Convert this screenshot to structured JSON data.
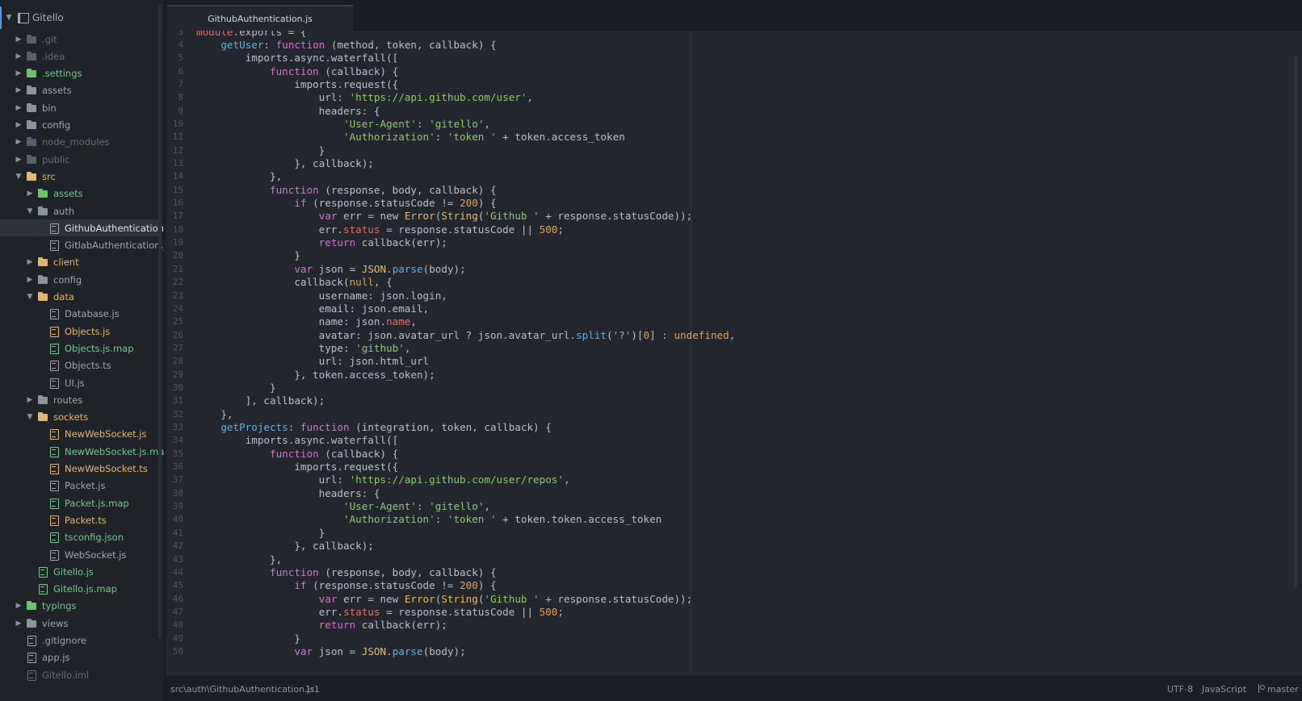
{
  "project": {
    "name": "Gitello",
    "icon": "repo-icon"
  },
  "tree": [
    {
      "label": ".git",
      "type": "folder",
      "depth": 1,
      "expanded": false,
      "status": "dim"
    },
    {
      "label": ".idea",
      "type": "folder",
      "depth": 1,
      "expanded": false,
      "status": "dim"
    },
    {
      "label": ".settings",
      "type": "folder",
      "depth": 1,
      "expanded": false,
      "status": "green"
    },
    {
      "label": "assets",
      "type": "folder",
      "depth": 1,
      "expanded": false,
      "status": "plain"
    },
    {
      "label": "bin",
      "type": "folder",
      "depth": 1,
      "expanded": false,
      "status": "plain"
    },
    {
      "label": "config",
      "type": "folder",
      "depth": 1,
      "expanded": false,
      "status": "plain"
    },
    {
      "label": "node_modules",
      "type": "folder",
      "depth": 1,
      "expanded": false,
      "status": "dim"
    },
    {
      "label": "public",
      "type": "folder",
      "depth": 1,
      "expanded": false,
      "status": "dim"
    },
    {
      "label": "src",
      "type": "folder",
      "depth": 1,
      "expanded": true,
      "status": "orange"
    },
    {
      "label": "assets",
      "type": "folder",
      "depth": 2,
      "expanded": false,
      "status": "green"
    },
    {
      "label": "auth",
      "type": "folder",
      "depth": 2,
      "expanded": true,
      "status": "plain"
    },
    {
      "label": "GithubAuthentication.js",
      "type": "file",
      "depth": 3,
      "status": "plain",
      "selected": true
    },
    {
      "label": "GitlabAuthentication.js",
      "type": "file",
      "depth": 3,
      "status": "plain"
    },
    {
      "label": "client",
      "type": "folder",
      "depth": 2,
      "expanded": false,
      "status": "orange"
    },
    {
      "label": "config",
      "type": "folder",
      "depth": 2,
      "expanded": false,
      "status": "plain"
    },
    {
      "label": "data",
      "type": "folder",
      "depth": 2,
      "expanded": true,
      "status": "orange"
    },
    {
      "label": "Database.js",
      "type": "file",
      "depth": 3,
      "status": "plain"
    },
    {
      "label": "Objects.js",
      "type": "file",
      "depth": 3,
      "status": "orange"
    },
    {
      "label": "Objects.js.map",
      "type": "file",
      "depth": 3,
      "status": "green"
    },
    {
      "label": "Objects.ts",
      "type": "file",
      "depth": 3,
      "status": "plain"
    },
    {
      "label": "UI.js",
      "type": "file",
      "depth": 3,
      "status": "plain"
    },
    {
      "label": "routes",
      "type": "folder",
      "depth": 2,
      "expanded": false,
      "status": "plain"
    },
    {
      "label": "sockets",
      "type": "folder",
      "depth": 2,
      "expanded": true,
      "status": "orange"
    },
    {
      "label": "NewWebSocket.js",
      "type": "file",
      "depth": 3,
      "status": "orange"
    },
    {
      "label": "NewWebSocket.js.map",
      "type": "file",
      "depth": 3,
      "status": "green"
    },
    {
      "label": "NewWebSocket.ts",
      "type": "file",
      "depth": 3,
      "status": "orange"
    },
    {
      "label": "Packet.js",
      "type": "file",
      "depth": 3,
      "status": "plain"
    },
    {
      "label": "Packet.js.map",
      "type": "file",
      "depth": 3,
      "status": "green"
    },
    {
      "label": "Packet.ts",
      "type": "file",
      "depth": 3,
      "status": "orange"
    },
    {
      "label": "tsconfig.json",
      "type": "file",
      "depth": 3,
      "status": "green"
    },
    {
      "label": "WebSocket.js",
      "type": "file",
      "depth": 3,
      "status": "plain"
    },
    {
      "label": "Gitello.js",
      "type": "file",
      "depth": 2,
      "status": "green"
    },
    {
      "label": "Gitello.js.map",
      "type": "file",
      "depth": 2,
      "status": "green"
    },
    {
      "label": "typings",
      "type": "folder",
      "depth": 1,
      "expanded": false,
      "status": "green"
    },
    {
      "label": "views",
      "type": "folder",
      "depth": 1,
      "expanded": false,
      "status": "plain"
    },
    {
      "label": ".gitignore",
      "type": "file",
      "depth": 1,
      "status": "plain"
    },
    {
      "label": "app.js",
      "type": "file",
      "depth": 1,
      "status": "plain"
    },
    {
      "label": "Gitello.iml",
      "type": "file",
      "depth": 1,
      "status": "dim"
    }
  ],
  "tab": {
    "title": "GithubAuthentication.js"
  },
  "editor": {
    "lines": [
      {
        "n": "3",
        "t": [
          [
            "prop",
            "module"
          ],
          [
            "p",
            ".exports = {"
          ]
        ]
      },
      {
        "n": "4",
        "t": [
          [
            "p",
            "    "
          ],
          [
            "fn",
            "getUser"
          ],
          [
            "p",
            ": "
          ],
          [
            "kw",
            "function"
          ],
          [
            "p",
            " (method, token, callback) {"
          ]
        ]
      },
      {
        "n": "5",
        "t": [
          [
            "p",
            "        imports.async.waterfall(["
          ]
        ]
      },
      {
        "n": "6",
        "t": [
          [
            "p",
            "            "
          ],
          [
            "kw",
            "function"
          ],
          [
            "p",
            " (callback) {"
          ]
        ]
      },
      {
        "n": "7",
        "t": [
          [
            "p",
            "                imports.request({"
          ]
        ]
      },
      {
        "n": "8",
        "t": [
          [
            "p",
            "                    url: "
          ],
          [
            "str",
            "'https://api.github.com/user'"
          ],
          [
            "p",
            ","
          ]
        ]
      },
      {
        "n": "9",
        "t": [
          [
            "p",
            "                    headers: {"
          ]
        ]
      },
      {
        "n": "10",
        "t": [
          [
            "p",
            "                        "
          ],
          [
            "str",
            "'User-Agent'"
          ],
          [
            "p",
            ": "
          ],
          [
            "str",
            "'gitello'"
          ],
          [
            "p",
            ","
          ]
        ]
      },
      {
        "n": "11",
        "t": [
          [
            "p",
            "                        "
          ],
          [
            "str",
            "'Authorization'"
          ],
          [
            "p",
            ": "
          ],
          [
            "str",
            "'token '"
          ],
          [
            "p",
            " + token.access_token"
          ]
        ]
      },
      {
        "n": "12",
        "t": [
          [
            "p",
            "                    }"
          ]
        ]
      },
      {
        "n": "13",
        "t": [
          [
            "p",
            "                }, callback);"
          ]
        ]
      },
      {
        "n": "14",
        "t": [
          [
            "p",
            "            },"
          ]
        ]
      },
      {
        "n": "15",
        "t": [
          [
            "p",
            "            "
          ],
          [
            "kw",
            "function"
          ],
          [
            "p",
            " (response, body, callback) {"
          ]
        ]
      },
      {
        "n": "16",
        "t": [
          [
            "p",
            "                "
          ],
          [
            "kw",
            "if"
          ],
          [
            "p",
            " (response.statusCode != "
          ],
          [
            "num",
            "200"
          ],
          [
            "p",
            ") {"
          ]
        ]
      },
      {
        "n": "17",
        "t": [
          [
            "p",
            "                    "
          ],
          [
            "kw",
            "var"
          ],
          [
            "p",
            " err = new "
          ],
          [
            "cls",
            "Error"
          ],
          [
            "p",
            "("
          ],
          [
            "cls",
            "String"
          ],
          [
            "p",
            "("
          ],
          [
            "str",
            "'Github '"
          ],
          [
            "p",
            " + response.statusCode));"
          ]
        ]
      },
      {
        "n": "18",
        "t": [
          [
            "p",
            "                    err."
          ],
          [
            "prop",
            "status"
          ],
          [
            "p",
            " = response.statusCode || "
          ],
          [
            "num",
            "500"
          ],
          [
            "p",
            ";"
          ]
        ]
      },
      {
        "n": "19",
        "t": [
          [
            "p",
            "                    "
          ],
          [
            "kw",
            "return"
          ],
          [
            "p",
            " callback(err);"
          ]
        ]
      },
      {
        "n": "20",
        "t": [
          [
            "p",
            "                }"
          ]
        ]
      },
      {
        "n": "21",
        "t": [
          [
            "p",
            "                "
          ],
          [
            "kw",
            "var"
          ],
          [
            "p",
            " json = "
          ],
          [
            "cls",
            "JSON"
          ],
          [
            "p",
            "."
          ],
          [
            "fn",
            "parse"
          ],
          [
            "p",
            "(body);"
          ]
        ]
      },
      {
        "n": "22",
        "t": [
          [
            "p",
            "                callback("
          ],
          [
            "num",
            "null"
          ],
          [
            "p",
            ", {"
          ]
        ]
      },
      {
        "n": "23",
        "t": [
          [
            "p",
            "                    username: json.login,"
          ]
        ]
      },
      {
        "n": "24",
        "t": [
          [
            "p",
            "                    email: json.email,"
          ]
        ]
      },
      {
        "n": "25",
        "t": [
          [
            "p",
            "                    name: json."
          ],
          [
            "prop",
            "name"
          ],
          [
            "p",
            ","
          ]
        ]
      },
      {
        "n": "26",
        "t": [
          [
            "p",
            "                    avatar: json.avatar_url ? json.avatar_url."
          ],
          [
            "fn",
            "split"
          ],
          [
            "p",
            "("
          ],
          [
            "str",
            "'?'"
          ],
          [
            "p",
            ")["
          ],
          [
            "num",
            "0"
          ],
          [
            "p",
            "] : "
          ],
          [
            "num",
            "undefined"
          ],
          [
            "p",
            ","
          ]
        ]
      },
      {
        "n": "27",
        "t": [
          [
            "p",
            "                    type: "
          ],
          [
            "str",
            "'github'"
          ],
          [
            "p",
            ","
          ]
        ]
      },
      {
        "n": "28",
        "t": [
          [
            "p",
            "                    url: json.html_url"
          ]
        ]
      },
      {
        "n": "29",
        "t": [
          [
            "p",
            "                }, token.access_token);"
          ]
        ]
      },
      {
        "n": "30",
        "t": [
          [
            "p",
            "            }"
          ]
        ]
      },
      {
        "n": "31",
        "t": [
          [
            "p",
            "        ], callback);"
          ]
        ]
      },
      {
        "n": "32",
        "t": [
          [
            "p",
            "    },"
          ]
        ]
      },
      {
        "n": "33",
        "t": [
          [
            "p",
            "    "
          ],
          [
            "fn",
            "getProjects"
          ],
          [
            "p",
            ": "
          ],
          [
            "kw",
            "function"
          ],
          [
            "p",
            " (integration, token, callback) {"
          ]
        ]
      },
      {
        "n": "34",
        "t": [
          [
            "p",
            "        imports.async.waterfall(["
          ]
        ]
      },
      {
        "n": "35",
        "t": [
          [
            "p",
            "            "
          ],
          [
            "kw",
            "function"
          ],
          [
            "p",
            " (callback) {"
          ]
        ]
      },
      {
        "n": "36",
        "t": [
          [
            "p",
            "                imports.request({"
          ]
        ]
      },
      {
        "n": "37",
        "t": [
          [
            "p",
            "                    url: "
          ],
          [
            "str",
            "'https://api.github.com/user/repos'"
          ],
          [
            "p",
            ","
          ]
        ]
      },
      {
        "n": "38",
        "t": [
          [
            "p",
            "                    headers: {"
          ]
        ]
      },
      {
        "n": "39",
        "t": [
          [
            "p",
            "                        "
          ],
          [
            "str",
            "'User-Agent'"
          ],
          [
            "p",
            ": "
          ],
          [
            "str",
            "'gitello'"
          ],
          [
            "p",
            ","
          ]
        ]
      },
      {
        "n": "40",
        "t": [
          [
            "p",
            "                        "
          ],
          [
            "str",
            "'Authorization'"
          ],
          [
            "p",
            ": "
          ],
          [
            "str",
            "'token '"
          ],
          [
            "p",
            " + token.token.access_token"
          ]
        ]
      },
      {
        "n": "41",
        "t": [
          [
            "p",
            "                    }"
          ]
        ]
      },
      {
        "n": "42",
        "t": [
          [
            "p",
            "                }, callback);"
          ]
        ]
      },
      {
        "n": "43",
        "t": [
          [
            "p",
            "            },"
          ]
        ]
      },
      {
        "n": "44",
        "t": [
          [
            "p",
            "            "
          ],
          [
            "kw",
            "function"
          ],
          [
            "p",
            " (response, body, callback) {"
          ]
        ]
      },
      {
        "n": "45",
        "t": [
          [
            "p",
            "                "
          ],
          [
            "kw",
            "if"
          ],
          [
            "p",
            " (response.statusCode != "
          ],
          [
            "num",
            "200"
          ],
          [
            "p",
            ") {"
          ]
        ]
      },
      {
        "n": "46",
        "t": [
          [
            "p",
            "                    "
          ],
          [
            "kw",
            "var"
          ],
          [
            "p",
            " err = new "
          ],
          [
            "cls",
            "Error"
          ],
          [
            "p",
            "("
          ],
          [
            "cls",
            "String"
          ],
          [
            "p",
            "("
          ],
          [
            "str",
            "'Github '"
          ],
          [
            "p",
            " + response.statusCode));"
          ]
        ]
      },
      {
        "n": "47",
        "t": [
          [
            "p",
            "                    err."
          ],
          [
            "prop",
            "status"
          ],
          [
            "p",
            " = response.statusCode || "
          ],
          [
            "num",
            "500"
          ],
          [
            "p",
            ";"
          ]
        ]
      },
      {
        "n": "48",
        "t": [
          [
            "p",
            "                    "
          ],
          [
            "kw",
            "return"
          ],
          [
            "p",
            " callback(err);"
          ]
        ]
      },
      {
        "n": "49",
        "t": [
          [
            "p",
            "                }"
          ]
        ]
      },
      {
        "n": "50",
        "t": [
          [
            "p",
            "                "
          ],
          [
            "kw",
            "var"
          ],
          [
            "p",
            " json = "
          ],
          [
            "cls",
            "JSON"
          ],
          [
            "p",
            "."
          ],
          [
            "fn",
            "parse"
          ],
          [
            "p",
            "(body);"
          ]
        ]
      }
    ]
  },
  "status": {
    "path": "src\\auth\\GithubAuthentication.js",
    "cursor": "1:1",
    "encoding": "UTF-8",
    "grammar": "JavaScript",
    "branch": "master"
  }
}
